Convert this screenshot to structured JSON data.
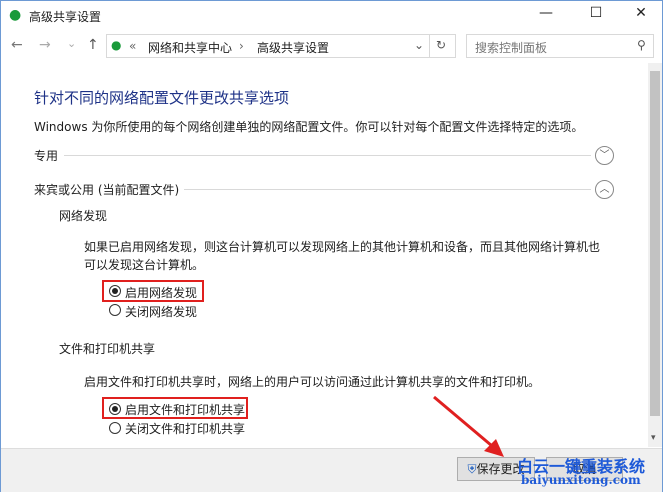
{
  "window": {
    "title": "高级共享设置",
    "minimize": "—",
    "maximize": "☐",
    "close": "✕"
  },
  "nav": {
    "back": "←",
    "forward": "→",
    "recent": "⌄",
    "up": "↑",
    "breadcrumb_sep": "«",
    "crumbs": [
      "网络和共享中心",
      "高级共享设置"
    ],
    "crumb_arrow": "›",
    "dropdown": "⌄",
    "refresh": "↻",
    "search_placeholder": "搜索控制面板",
    "search_icon": "⚲"
  },
  "main": {
    "heading": "针对不同的网络配置文件更改共享选项",
    "description": "Windows 为你所使用的每个网络创建单独的网络配置文件。你可以针对每个配置文件选择特定的选项。",
    "profiles": [
      {
        "label": "专用",
        "expanded": false
      },
      {
        "label": "来宾或公用 (当前配置文件)",
        "expanded": true
      }
    ],
    "network_discovery": {
      "title": "网络发现",
      "desc1": "如果已启用网络发现，则这台计算机可以发现网络上的其他计算机和设备，而且其他网络计算机也",
      "desc2": "可以发现这台计算机。",
      "options": [
        "启用网络发现",
        "关闭网络发现"
      ],
      "selected": 0
    },
    "file_sharing": {
      "title": "文件和打印机共享",
      "desc": "启用文件和打印机共享时，网络上的用户可以访问通过此计算机共享的文件和打印机。",
      "options": [
        "启用文件和打印机共享",
        "关闭文件和打印机共享"
      ],
      "selected": 0
    }
  },
  "footer": {
    "save": "保存更改",
    "cancel": "取消"
  },
  "watermark": {
    "line1": "白云一键重装系统",
    "line2": "baiyunxitong.com"
  },
  "colors": {
    "heading": "#1e3287",
    "highlight": "#e0201e"
  }
}
